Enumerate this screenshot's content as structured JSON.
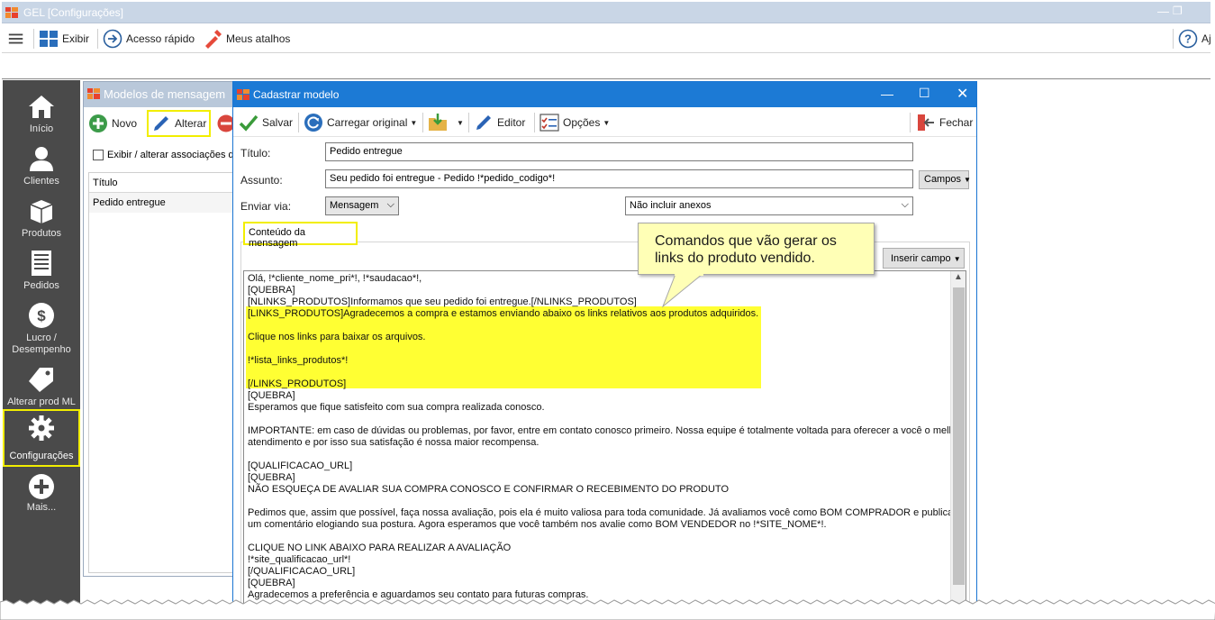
{
  "main_window": {
    "title": "GEL [Configurações]",
    "toolbar": {
      "exibir": "Exibir",
      "acesso_rapido": "Acesso rápido",
      "meus_atalhos": "Meus atalhos",
      "help_partial": "Aj"
    }
  },
  "sidebar": {
    "items": [
      {
        "label": "Início",
        "icon": "home-icon"
      },
      {
        "label": "Clientes",
        "icon": "user-icon"
      },
      {
        "label": "Produtos",
        "icon": "box-icon"
      },
      {
        "label": "Pedidos",
        "icon": "document-icon"
      },
      {
        "label": "Lucro /",
        "label2": "Desempenho",
        "icon": "dollar-icon"
      },
      {
        "label": "Alterar prod ML",
        "icon": "tag-icon"
      },
      {
        "label": "Configurações",
        "icon": "gear-icon",
        "active": true
      },
      {
        "label": "Mais...",
        "icon": "plus-circle-icon"
      }
    ]
  },
  "modelos": {
    "title": "Modelos de mensagem",
    "novo": "Novo",
    "alterar": "Alterar",
    "check_label": "Exibir / alterar associações d",
    "column_header": "Título",
    "rows": [
      "Pedido entregue"
    ]
  },
  "dialog": {
    "title": "Cadastrar modelo",
    "toolbar": {
      "salvar": "Salvar",
      "carregar_original": "Carregar original",
      "editor": "Editor",
      "opcoes": "Opções",
      "fechar": "Fechar"
    },
    "titulo_label": "Título:",
    "titulo_value": "Pedido entregue",
    "assunto_label": "Assunto:",
    "assunto_value": "Seu pedido foi entregue - Pedido !*pedido_codigo*!",
    "campos_button": "Campos",
    "enviar_via_label": "Enviar via:",
    "enviar_via_value": "Mensagem",
    "anexos_value": "Não incluir anexos",
    "tab_label": "Conteúdo da mensagem",
    "inserir_campo": "Inserir campo",
    "content_lines": [
      "Olá, !*cliente_nome_pri*!, !*saudacao*!,",
      "[QUEBRA]",
      "[NLINKS_PRODUTOS]Informamos que seu pedido foi entregue.[/NLINKS_PRODUTOS]",
      "[LINKS_PRODUTOS]Agradecemos a compra e estamos enviando abaixo os links relativos aos produtos adquiridos.",
      "",
      "Clique nos links para baixar os arquivos.",
      "",
      "!*lista_links_produtos*!",
      "",
      "[/LINKS_PRODUTOS]",
      "[QUEBRA]",
      "Esperamos que fique satisfeito com sua compra realizada conosco.",
      "",
      "IMPORTANTE: em caso de dúvidas ou problemas, por favor, entre em contato conosco primeiro. Nossa equipe é totalmente voltada para oferecer a você o melhor",
      "atendimento e por isso sua satisfação é nossa maior recompensa.",
      "",
      "[QUALIFICACAO_URL]",
      "[QUEBRA]",
      "NÃO ESQUEÇA DE AVALIAR SUA COMPRA CONOSCO E CONFIRMAR O RECEBIMENTO DO PRODUTO",
      "",
      "Pedimos que, assim que possível, faça nossa avaliação, pois ela é muito valiosa para toda comunidade. Já avaliamos você como BOM COMPRADOR e publicamos",
      "um comentário elogiando sua postura. Agora esperamos que você também nos avalie como BOM VENDEDOR no !*SITE_NOME*!.",
      "",
      "CLIQUE NO LINK ABAIXO PARA REALIZAR A AVALIAÇÃO",
      "!*site_qualificacao_url*!",
      "[/QUALIFICACAO_URL]",
      "[QUEBRA]",
      "Agradecemos a preferência e aguardamos seu contato para futuras compras."
    ]
  },
  "callout": {
    "line1": "Comandos que vão gerar os",
    "line2": "links do produto vendido."
  },
  "colors": {
    "highlight": "#ffff33",
    "accent_blue": "#1c7ad5",
    "sidebar": "#4a4a4a",
    "callout": "#ffffb6"
  }
}
